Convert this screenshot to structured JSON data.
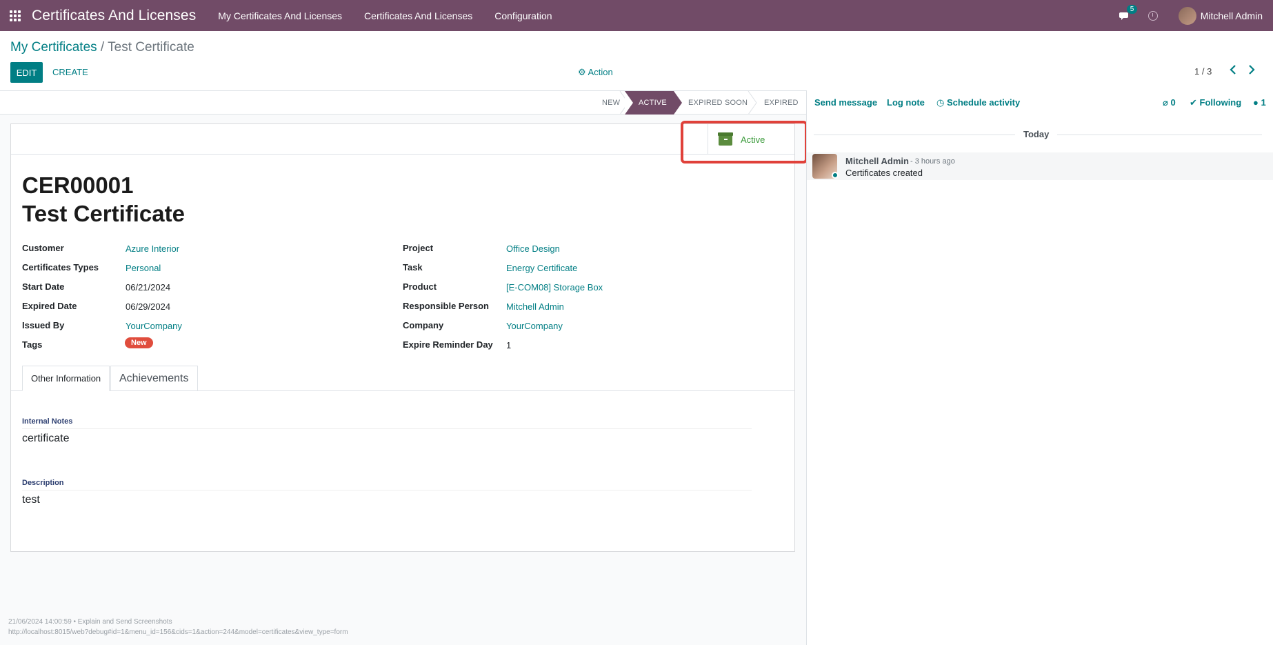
{
  "navbar": {
    "brand": "Certificates And Licenses",
    "menus": [
      "My Certificates And Licenses",
      "Certificates And Licenses",
      "Configuration"
    ],
    "chat_count": "5",
    "user": "Mitchell Admin"
  },
  "breadcrumb": {
    "parent": "My Certificates",
    "separator": "/",
    "current": "Test Certificate"
  },
  "toolbar": {
    "edit": "EDIT",
    "create": "CREATE",
    "action": "⚙ Action",
    "pager": "1 / 3"
  },
  "statusbar": {
    "stages": [
      "NEW",
      "ACTIVE",
      "EXPIRED SOON",
      "EXPIRED"
    ],
    "current": "ACTIVE"
  },
  "smart_button": {
    "label": "Active"
  },
  "record": {
    "reference": "CER00001",
    "name": "Test Certificate"
  },
  "left_fields": [
    {
      "label": "Customer",
      "value": "Azure Interior",
      "link": true
    },
    {
      "label": "Certificates Types",
      "value": "Personal",
      "link": true
    },
    {
      "label": "Start Date",
      "value": "06/21/2024",
      "link": false
    },
    {
      "label": "Expired Date",
      "value": "06/29/2024",
      "link": false
    },
    {
      "label": "Issued By",
      "value": "YourCompany",
      "link": true
    },
    {
      "label": "Tags",
      "value": "New",
      "link": false
    }
  ],
  "right_fields": [
    {
      "label": "Project",
      "value": "Office Design",
      "link": true
    },
    {
      "label": "Task",
      "value": "Energy Certificate",
      "link": true
    },
    {
      "label": "Product",
      "value": "[E-COM08] Storage Box",
      "link": true
    },
    {
      "label": "Responsible Person",
      "value": "Mitchell Admin",
      "link": true
    },
    {
      "label": "Company",
      "value": "YourCompany",
      "link": true
    },
    {
      "label": "Expire Reminder Day",
      "value": "1",
      "link": false
    }
  ],
  "tabs": {
    "active": "Other Information",
    "inactive": "Achievements"
  },
  "notes": {
    "internal_label": "Internal Notes",
    "internal_value": "certificate",
    "description_label": "Description",
    "description_value": "test"
  },
  "debug": {
    "line1": "21/06/2024 14:00:59 • Explain and Send Screenshots",
    "line2": "http://localhost:8015/web?debug#id=1&menu_id=156&cids=1&action=244&model=certificates&view_type=form"
  },
  "chatter": {
    "send_message": "Send message",
    "log_note": "Log note",
    "schedule_activity": "Schedule activity",
    "attachments": "0",
    "following": "Following",
    "followers": "1",
    "today": "Today",
    "message_author": "Mitchell Admin",
    "message_time": "- 3 hours ago",
    "message_body": "Certificates created"
  },
  "colors": {
    "brand": "#714b67",
    "link": "#017e84",
    "highlight": "#e0413a",
    "tag": "#e04d3d"
  }
}
